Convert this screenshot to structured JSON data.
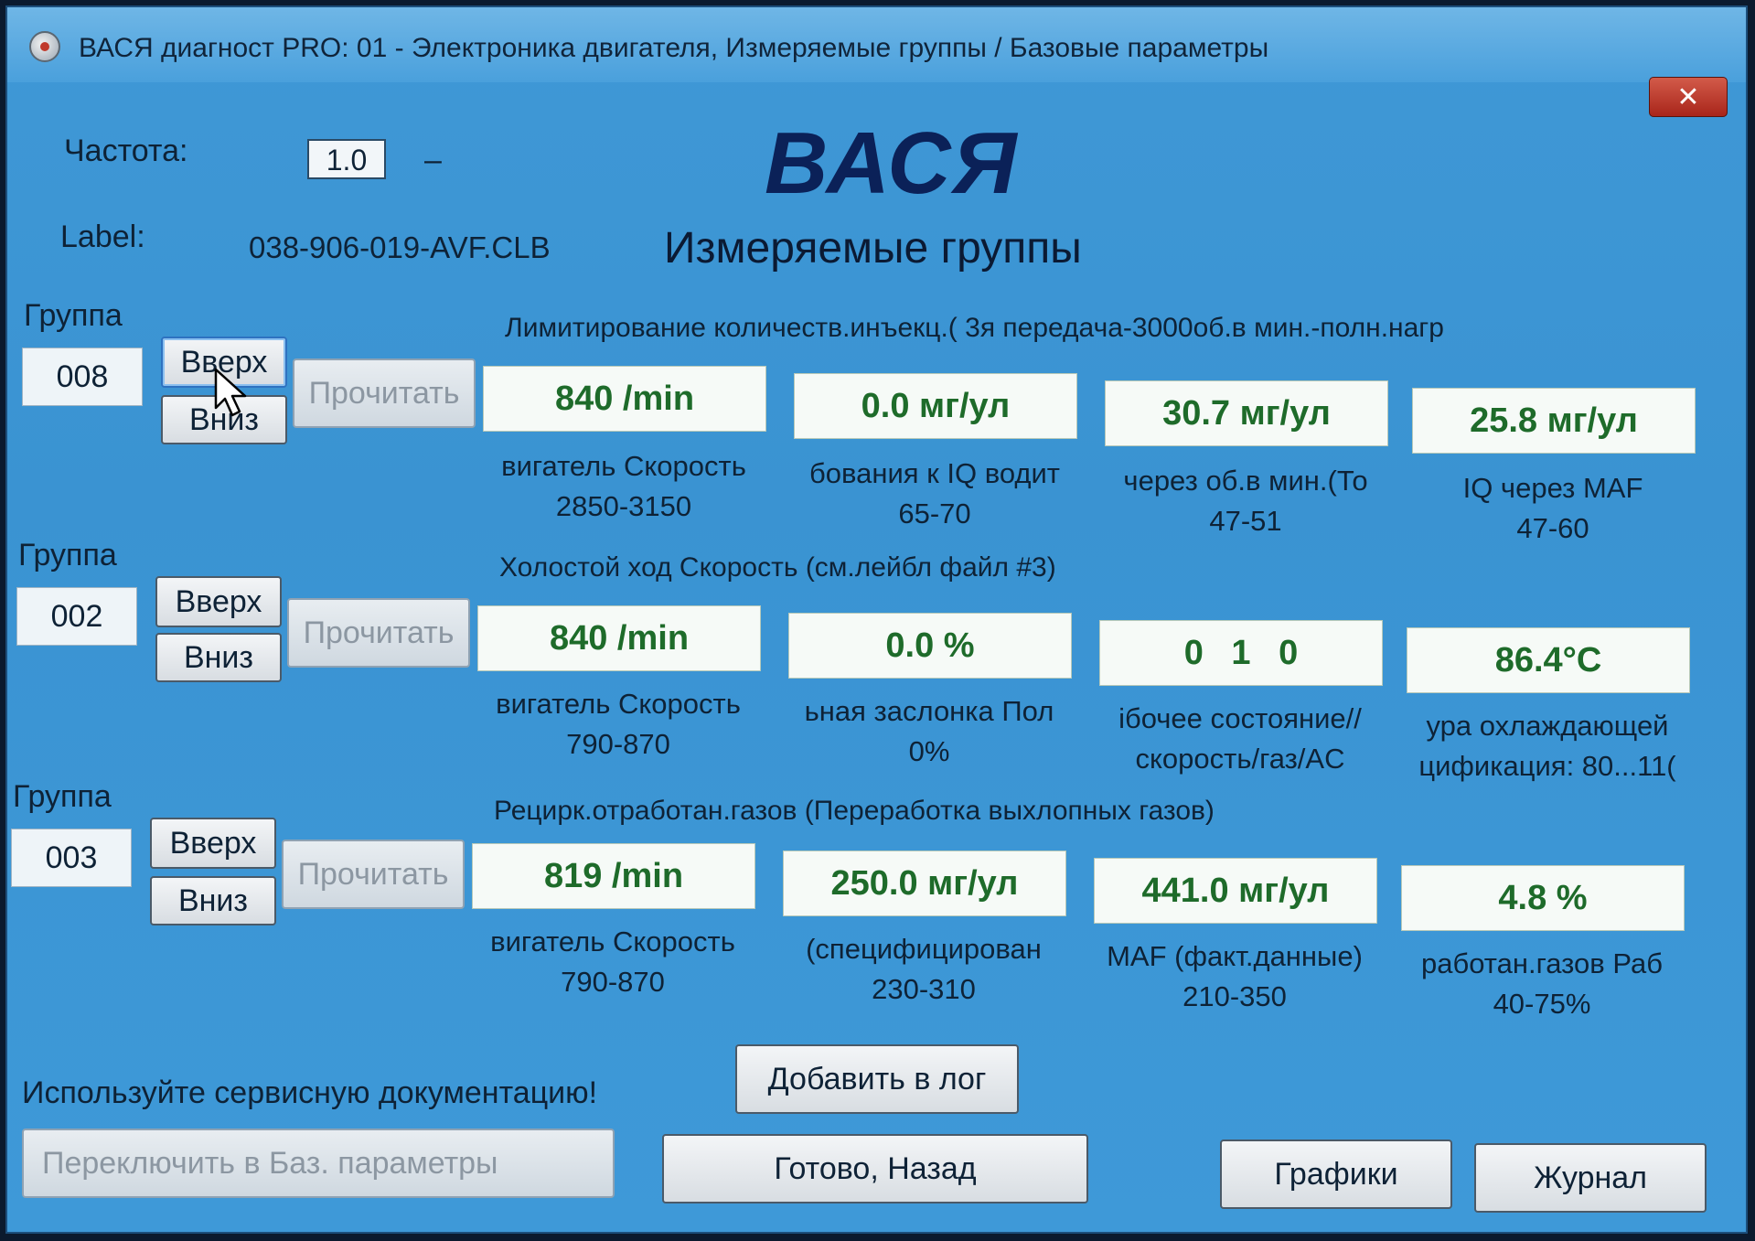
{
  "window": {
    "title": "ВАСЯ диагност PRO: 01 - Электроника двигателя,  Измеряемые группы / Базовые параметры",
    "close_label": "✕"
  },
  "header": {
    "freq_label": "Частота:",
    "freq_value": "1.0",
    "freq_suffix": "–",
    "label_label": "Label:",
    "label_value": "038-906-019-AVF.CLB",
    "brand": "ВАСЯ",
    "subtitle": "Измеряемые группы"
  },
  "common": {
    "group_label": "Группа",
    "up_label": "Вверх",
    "down_label": "Вниз",
    "read_label": "Прочитать"
  },
  "groups": [
    {
      "number": "008",
      "description": "Лимитирование количеств.инъекц.( 3я передача-3000об.в мин.-полн.нагр",
      "values": [
        {
          "value": "840 /min",
          "label": "вигатель Скорость",
          "range": "2850-3150"
        },
        {
          "value": "0.0 мг/ул",
          "label": "бования к IQ водит",
          "range": "65-70"
        },
        {
          "value": "30.7 мг/ул",
          "label": "через об.в мин.(То",
          "range": "47-51"
        },
        {
          "value": "25.8 мг/ул",
          "label": "IQ через MAF",
          "range": "47-60"
        }
      ]
    },
    {
      "number": "002",
      "description": "Холостой ход Скорость (см.лейбл файл #3)",
      "values": [
        {
          "value": "840 /min",
          "label": "вигатель Скорость",
          "range": "790-870"
        },
        {
          "value": "0.0 %",
          "label": "ьная заслонка Пол",
          "range": "0%"
        },
        {
          "value": "0 1 0",
          "label": "ібочее состояние//",
          "range": "скорость/газ/AC"
        },
        {
          "value": "86.4°C",
          "label": "ура охлаждающей",
          "range": "цификация: 80...11("
        }
      ]
    },
    {
      "number": "003",
      "description": "Рецирк.отработан.газов (Переработка выхлопных газов)",
      "values": [
        {
          "value": "819 /min",
          "label": "вигатель Скорость",
          "range": "790-870"
        },
        {
          "value": "250.0 мг/ул",
          "label": "(специфицирован",
          "range": "230-310"
        },
        {
          "value": "441.0 мг/ул",
          "label": "MAF (факт.данные)",
          "range": "210-350"
        },
        {
          "value": "4.8 %",
          "label": "работан.газов Раб",
          "range": "40-75%"
        }
      ]
    }
  ],
  "footer": {
    "note": "Используйте сервисную документацию!",
    "add_log": "Добавить в лог",
    "switch_basic": "Переключить в Баз. параметры",
    "done_back": "Готово, Назад",
    "graphs": "Графики",
    "journal": "Журнал"
  },
  "colors": {
    "window_bg": "#3f98d6",
    "value_text": "#1e6b2a",
    "brand": "#0b2158",
    "close_btn": "#b8352a"
  }
}
